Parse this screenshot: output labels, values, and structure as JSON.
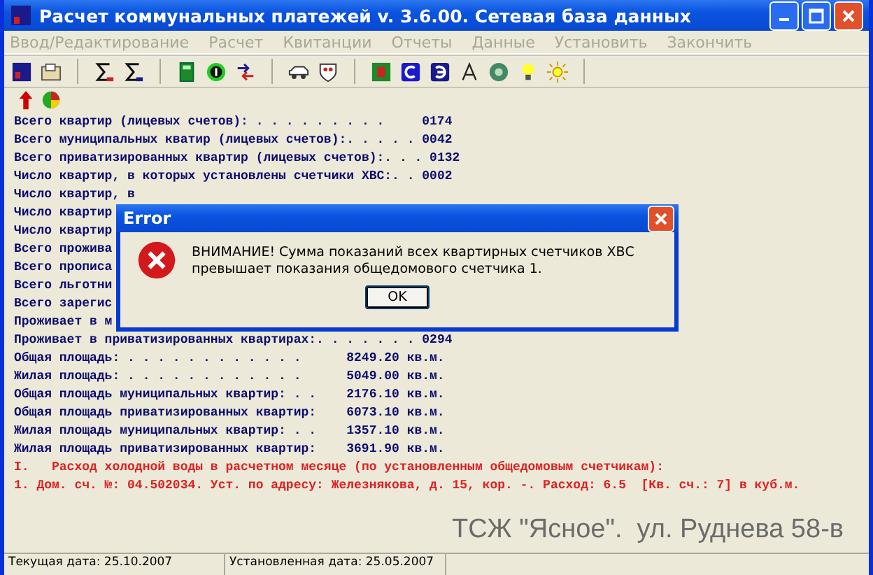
{
  "window": {
    "title": "Расчет коммунальных платежей v. 3.6.00. Сетевая база данных"
  },
  "menu": [
    {
      "label": "Ввод/Редактирование",
      "disabled": true
    },
    {
      "label": "Расчет",
      "disabled": true
    },
    {
      "label": "Квитанции",
      "disabled": true
    },
    {
      "label": "Отчеты",
      "disabled": true
    },
    {
      "label": "Данные",
      "disabled": true
    },
    {
      "label": "Установить",
      "disabled": true
    },
    {
      "label": "Закончить",
      "disabled": true
    }
  ],
  "report": {
    "counts": [
      {
        "label": "Всего квартир (лицевых счетов): . . . . . . . . .",
        "value": "0174"
      },
      {
        "label": "Всего муниципальных кватир (лицевых счетов):. . . . .",
        "value": "0042"
      },
      {
        "label": "Всего приватизированных квартир (лицевых счетов):. . .",
        "value": "0132"
      },
      {
        "label": "Число квартир, в которых установлены счетчики ХВС:. .",
        "value": "0002"
      },
      {
        "label": "Число квартир, в"
      },
      {
        "label": "Число квартир"
      },
      {
        "label": "Число квартир"
      },
      {
        "label": "Всего прожива"
      },
      {
        "label": "Всего прописа"
      },
      {
        "label": "Всего льготни"
      },
      {
        "label": "Всего зарегис"
      },
      {
        "label": "Проживает в м"
      },
      {
        "label": "Проживает в приватизированных квартирах:. . . . . . .",
        "value": "0294"
      }
    ],
    "areas": [
      {
        "label": "Общая площадь: . . . . . . . . . . . .",
        "value": "8249.20 кв.м."
      },
      {
        "label": "Жилая площадь: . . . . . . . . . . . .",
        "value": "5049.00 кв.м."
      },
      {
        "label": "Общая площадь муниципальных квартир: . .",
        "value": "2176.10 кв.м."
      },
      {
        "label": "Общая площадь приватизированных квартир:",
        "value": "6073.10 кв.м."
      },
      {
        "label": "Жилая площадь муниципальных квартир: . .",
        "value": "1357.10 кв.м."
      },
      {
        "label": "Жилая площадь приватизированных квартир:",
        "value": "3691.90 кв.м."
      }
    ],
    "notes": [
      "I.   Расход холодной воды в расчетном месяце (по установленным общедомовым счетчикам):",
      "1. Дом. сч. №: 04.502034. Уст. по адресу: Железнякова, д. 15, кор. -. Расход: 6.5  [Кв. сч.: 7] в куб.м."
    ]
  },
  "caption": "ТСЖ \"Ясное\".  ул. Руднева 58-в",
  "dialog": {
    "title": "Error",
    "message": "ВНИМАНИЕ! Сумма показаний всех квартирных счетчиков ХВС превышает показания общедомового счетчика 1.",
    "buttons": [
      "OK"
    ]
  },
  "status_bar": [
    "Текущая дата: 25.10.2007",
    "Установленная дата: 25.05.2007"
  ]
}
